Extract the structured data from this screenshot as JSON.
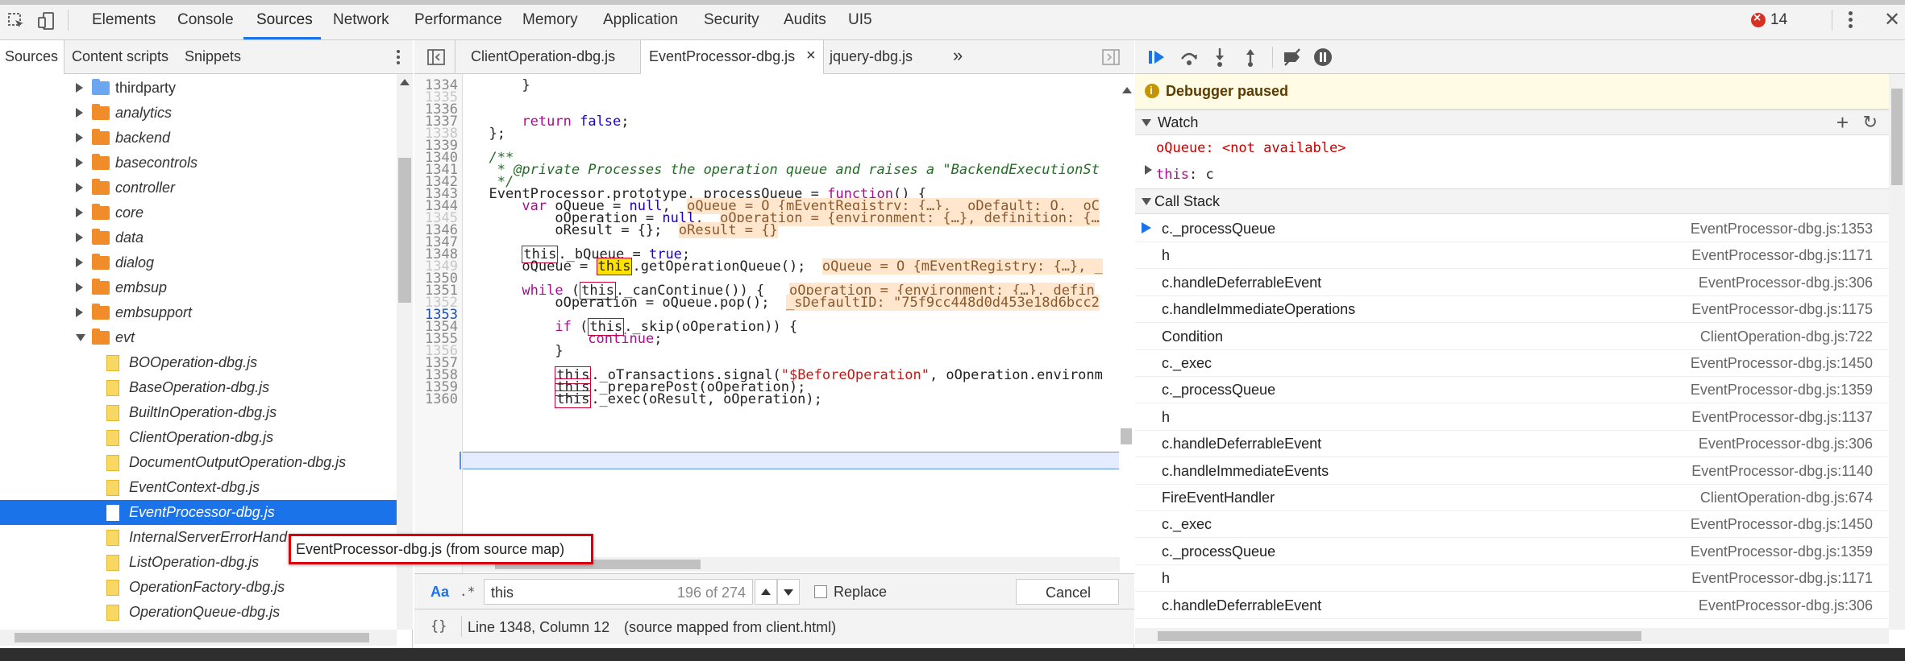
{
  "main_tabs": [
    "Elements",
    "Console",
    "Sources",
    "Network",
    "Performance",
    "Memory",
    "Application",
    "Security",
    "Audits",
    "UI5"
  ],
  "error_count": "14",
  "navigator": {
    "tabs": [
      "Sources",
      "Content scripts",
      "Snippets"
    ],
    "tree": [
      {
        "label": "thirdparty",
        "kind": "folder-blue"
      },
      {
        "label": "analytics",
        "kind": "folder"
      },
      {
        "label": "backend",
        "kind": "folder"
      },
      {
        "label": "basecontrols",
        "kind": "folder"
      },
      {
        "label": "controller",
        "kind": "folder"
      },
      {
        "label": "core",
        "kind": "folder"
      },
      {
        "label": "data",
        "kind": "folder"
      },
      {
        "label": "dialog",
        "kind": "folder"
      },
      {
        "label": "embsup",
        "kind": "folder"
      },
      {
        "label": "embsupport",
        "kind": "folder"
      },
      {
        "label": "evt",
        "kind": "folder-open"
      },
      {
        "label": "BOOperation-dbg.js",
        "kind": "file"
      },
      {
        "label": "BaseOperation-dbg.js",
        "kind": "file"
      },
      {
        "label": "BuiltInOperation-dbg.js",
        "kind": "file"
      },
      {
        "label": "ClientOperation-dbg.js",
        "kind": "file"
      },
      {
        "label": "DocumentOutputOperation-dbg.js",
        "kind": "file"
      },
      {
        "label": "EventContext-dbg.js",
        "kind": "file"
      },
      {
        "label": "EventProcessor-dbg.js",
        "kind": "file-selected"
      },
      {
        "label": "InternalServerErrorHand",
        "kind": "file"
      },
      {
        "label": "ListOperation-dbg.js",
        "kind": "file"
      },
      {
        "label": "OperationFactory-dbg.js",
        "kind": "file"
      },
      {
        "label": "OperationQueue-dbg.js",
        "kind": "file"
      }
    ]
  },
  "editor": {
    "tabs": [
      "ClientOperation-dbg.js",
      "EventProcessor-dbg.js",
      "jquery-dbg.js"
    ],
    "close_glyph": "×",
    "more_glyph": "»",
    "line_numbers": [
      "1334",
      "1335",
      "1336",
      "1337",
      "1338",
      "1339",
      "1340",
      "1341",
      "1342",
      "1343",
      "1344",
      "1345",
      "1346",
      "1347",
      "1348",
      "1349",
      "1350",
      "1351",
      "1352",
      "1353",
      "1354",
      "1355",
      "1356",
      "1357",
      "1358",
      "1359",
      "1360"
    ],
    "search": {
      "case_label": "Aa",
      "regex_label": ".*",
      "query": "this",
      "count": "196 of 274",
      "replace_label": "Replace",
      "cancel_label": "Cancel"
    },
    "status": {
      "brace_glyph": "{}",
      "position": "Line 1348, Column 12",
      "source_map": "(source mapped from client.html)"
    }
  },
  "tooltip": "EventProcessor-dbg.js (from source map)",
  "debugger": {
    "paused_text": "Debugger paused",
    "watch_label": "Watch",
    "watch": [
      {
        "name": "oQueue",
        "value": "<not available>"
      },
      {
        "name": "this",
        "value": "c"
      }
    ],
    "callstack_label": "Call Stack",
    "callstack": [
      {
        "fn": "c._processQueue",
        "loc": "EventProcessor-dbg.js:1353",
        "current": true
      },
      {
        "fn": "h",
        "loc": "EventProcessor-dbg.js:1171"
      },
      {
        "fn": "c.handleDeferrableEvent",
        "loc": "EventProcessor-dbg.js:306"
      },
      {
        "fn": "c.handleImmediateOperations",
        "loc": "EventProcessor-dbg.js:1175"
      },
      {
        "fn": "Condition",
        "loc": "ClientOperation-dbg.js:722"
      },
      {
        "fn": "c._exec",
        "loc": "EventProcessor-dbg.js:1450"
      },
      {
        "fn": "c._processQueue",
        "loc": "EventProcessor-dbg.js:1359"
      },
      {
        "fn": "h",
        "loc": "EventProcessor-dbg.js:1137"
      },
      {
        "fn": "c.handleDeferrableEvent",
        "loc": "EventProcessor-dbg.js:306"
      },
      {
        "fn": "c.handleImmediateEvents",
        "loc": "EventProcessor-dbg.js:1140"
      },
      {
        "fn": "FireEventHandler",
        "loc": "ClientOperation-dbg.js:674"
      },
      {
        "fn": "c._exec",
        "loc": "EventProcessor-dbg.js:1450"
      },
      {
        "fn": "c._processQueue",
        "loc": "EventProcessor-dbg.js:1359"
      },
      {
        "fn": "h",
        "loc": "EventProcessor-dbg.js:1171"
      },
      {
        "fn": "c.handleDeferrableEvent",
        "loc": "EventProcessor-dbg.js:306"
      }
    ]
  },
  "colors": {
    "accent": "#1a73e8",
    "folder": "#f08d2a",
    "file": "#f8d862",
    "error": "#d93025",
    "paused_bg": "#fffbe5"
  }
}
